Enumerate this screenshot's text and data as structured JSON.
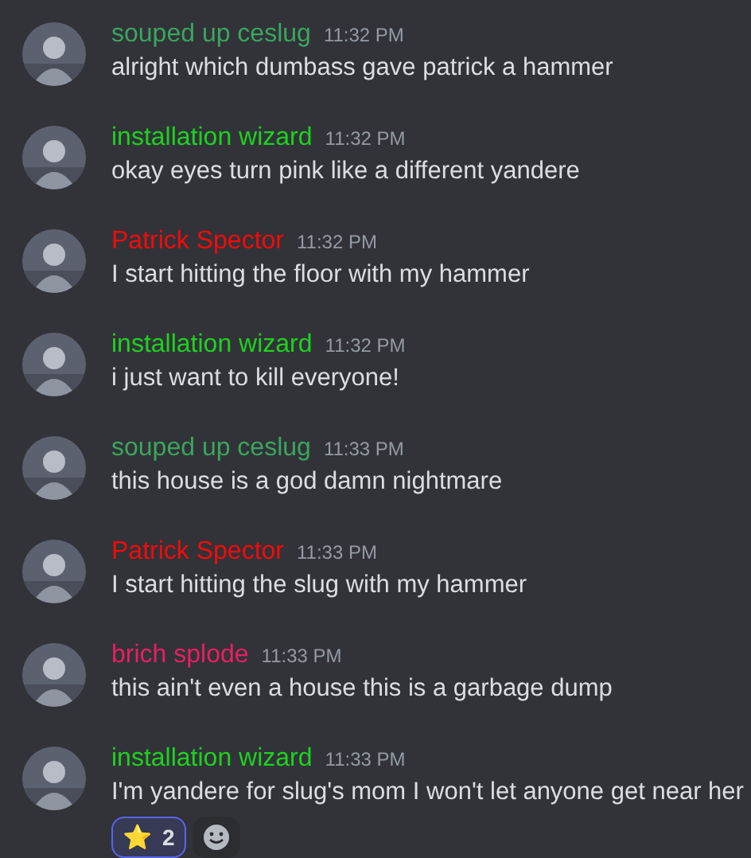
{
  "messages": [
    {
      "author": "souped up ceslug",
      "color": "#3ba55d",
      "time": "11:32 PM",
      "text": "alright which dumbass gave patrick a hammer"
    },
    {
      "author": "installation wizard",
      "color": "#1fd11f",
      "time": "11:32 PM",
      "text": "okay eyes turn pink like a different yandere"
    },
    {
      "author": "Patrick Spector",
      "color": "#f50a0a",
      "time": "11:32 PM",
      "text": "I start hitting the floor with my hammer"
    },
    {
      "author": "installation wizard",
      "color": "#1fd11f",
      "time": "11:32 PM",
      "text": "i just want to kill everyone!"
    },
    {
      "author": "souped up ceslug",
      "color": "#3ba55d",
      "time": "11:33 PM",
      "text": "this house is a god damn nightmare"
    },
    {
      "author": "Patrick Spector",
      "color": "#f50a0a",
      "time": "11:33 PM",
      "text": "I start hitting the slug with my hammer"
    },
    {
      "author": "brich splode",
      "color": "#e91e63",
      "time": "11:33 PM",
      "text": "this ain't even a house this is a garbage dump"
    },
    {
      "author": "installation wizard",
      "color": "#1fd11f",
      "time": "11:33 PM",
      "text": "I'm yandere for slug's mom I won't let anyone get near her",
      "reactions": [
        {
          "emoji": "⭐",
          "count": "2",
          "selected": true
        }
      ]
    }
  ]
}
